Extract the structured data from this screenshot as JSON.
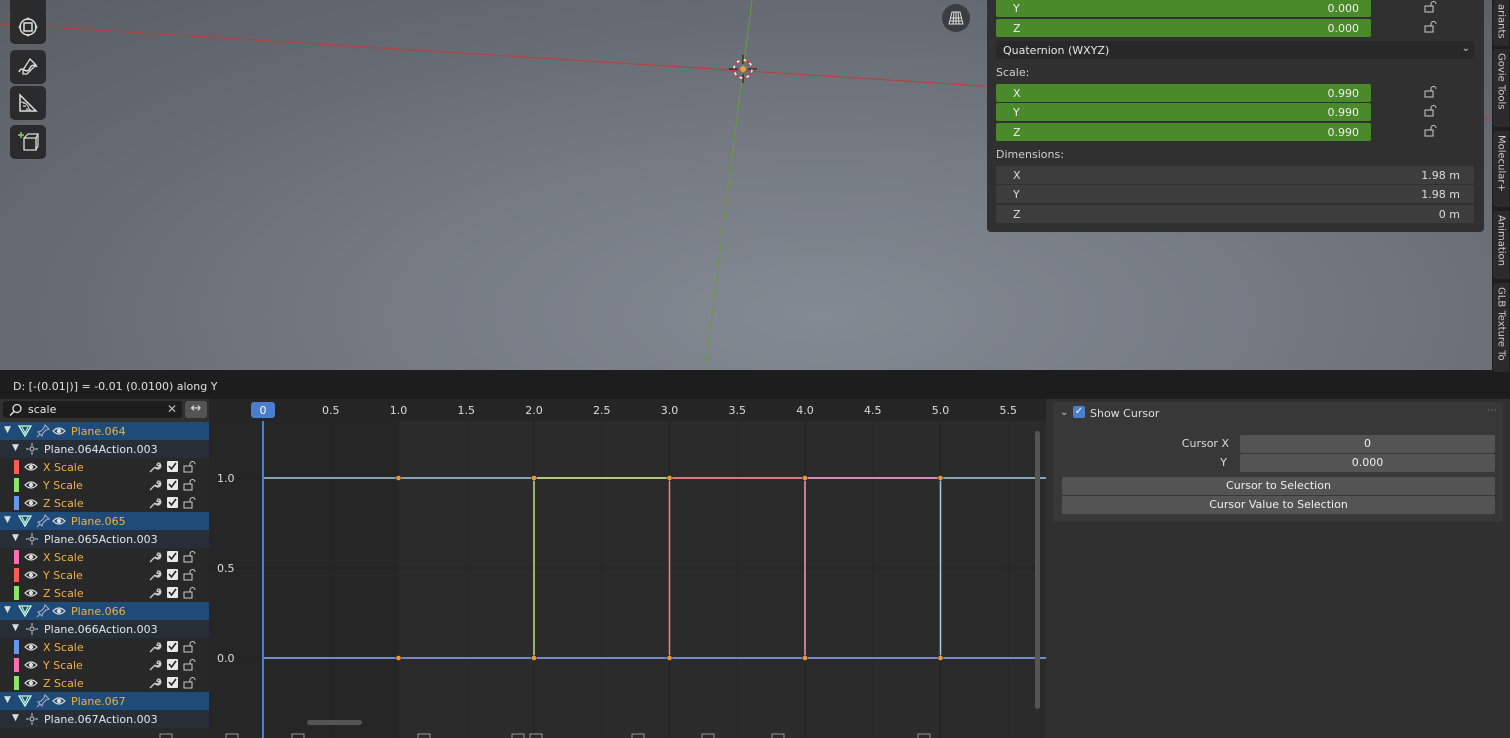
{
  "viewport": {
    "rotation": {
      "y": {
        "label": "Y",
        "value": "0.000"
      },
      "z": {
        "label": "Z",
        "value": "0.000"
      }
    },
    "rotation_mode": "Quaternion (WXYZ)",
    "scale_label": "Scale:",
    "scale": {
      "x": {
        "label": "X",
        "value": "0.990"
      },
      "y": {
        "label": "Y",
        "value": "0.990"
      },
      "z": {
        "label": "Z",
        "value": "0.990"
      }
    },
    "dimensions_label": "Dimensions:",
    "dimensions": {
      "x": {
        "label": "X",
        "value": "1.98 m"
      },
      "y": {
        "label": "Y",
        "value": "1.98 m"
      },
      "z": {
        "label": "Z",
        "value": "0 m"
      }
    },
    "side_tabs": [
      "ariants",
      "Govie Tools",
      "Molecular+",
      "Animation",
      "GLB Texture To"
    ]
  },
  "status_text": "D: [-(0.01|)] = -0.01  (0.0100) along Y",
  "graph_editor": {
    "search_value": "scale",
    "ticks": [
      "0.5",
      "1.0",
      "1.5",
      "2.0",
      "2.5",
      "3.0",
      "3.5",
      "4.0",
      "4.5",
      "5.0",
      "5.5"
    ],
    "current_frame": "0",
    "y_labels": [
      "1.0",
      "0.5",
      "0.0"
    ],
    "channels": [
      {
        "type": "object",
        "name": "Plane.064"
      },
      {
        "type": "action",
        "name": "Plane.064Action.003"
      },
      {
        "type": "fcurve",
        "name": "X Scale",
        "color": "#ff5a5a"
      },
      {
        "type": "fcurve",
        "name": "Y Scale",
        "color": "#8fe36b"
      },
      {
        "type": "fcurve",
        "name": "Z Scale",
        "color": "#6a95e8"
      },
      {
        "type": "object",
        "name": "Plane.065"
      },
      {
        "type": "action",
        "name": "Plane.065Action.003"
      },
      {
        "type": "fcurve",
        "name": "X Scale",
        "color": "#ff6fb0"
      },
      {
        "type": "fcurve",
        "name": "Y Scale",
        "color": "#ff5a5a"
      },
      {
        "type": "fcurve",
        "name": "Z Scale",
        "color": "#8fe36b"
      },
      {
        "type": "object",
        "name": "Plane.066"
      },
      {
        "type": "action",
        "name": "Plane.066Action.003"
      },
      {
        "type": "fcurve",
        "name": "X Scale",
        "color": "#6a95e8"
      },
      {
        "type": "fcurve",
        "name": "Y Scale",
        "color": "#ff6fb0"
      },
      {
        "type": "fcurve",
        "name": "Z Scale",
        "color": "#8fe36b"
      },
      {
        "type": "object",
        "name": "Plane.067"
      },
      {
        "type": "action",
        "name": "Plane.067Action.003"
      }
    ]
  },
  "chart_data": {
    "type": "line",
    "x_range": [
      -0.5,
      5.8
    ],
    "y_range": [
      -0.35,
      1.3
    ],
    "series": [
      {
        "color": "#9fd0e6",
        "points": [
          [
            0,
            1.0
          ],
          [
            5.8,
            1.0
          ]
        ]
      },
      {
        "color": "#8fa8ff",
        "points": [
          [
            0,
            0.0
          ],
          [
            5.8,
            0.0
          ]
        ]
      },
      {
        "color": "#c8e07a",
        "points": [
          [
            2.0,
            0.0
          ],
          [
            2.0,
            1.0
          ],
          [
            3.0,
            1.0
          ]
        ]
      },
      {
        "color": "#ff7a7a",
        "points": [
          [
            3.0,
            0.0
          ],
          [
            3.0,
            1.0
          ],
          [
            4.0,
            1.0
          ]
        ]
      },
      {
        "color": "#ff8fc8",
        "points": [
          [
            4.0,
            0.0
          ],
          [
            4.0,
            1.0
          ],
          [
            5.0,
            1.0
          ]
        ]
      },
      {
        "color": "#a8d0e0",
        "points": [
          [
            5.0,
            0.0
          ],
          [
            5.0,
            1.0
          ]
        ]
      }
    ],
    "keyframes": [
      [
        1.0,
        1.0
      ],
      [
        2.0,
        1.0
      ],
      [
        3.0,
        1.0
      ],
      [
        4.0,
        1.0
      ],
      [
        5.0,
        1.0
      ],
      [
        1.0,
        0.0
      ],
      [
        2.0,
        0.0
      ],
      [
        3.0,
        0.0
      ],
      [
        4.0,
        0.0
      ],
      [
        5.0,
        0.0
      ]
    ]
  },
  "cursor_panel": {
    "title": "Show Cursor",
    "cursor_x_label": "Cursor X",
    "cursor_x_value": "0",
    "y_label": "Y",
    "y_value": "0.000",
    "btn_cursor_to_selection": "Cursor to Selection",
    "btn_cursor_value_to_selection": "Cursor Value to Selection"
  }
}
